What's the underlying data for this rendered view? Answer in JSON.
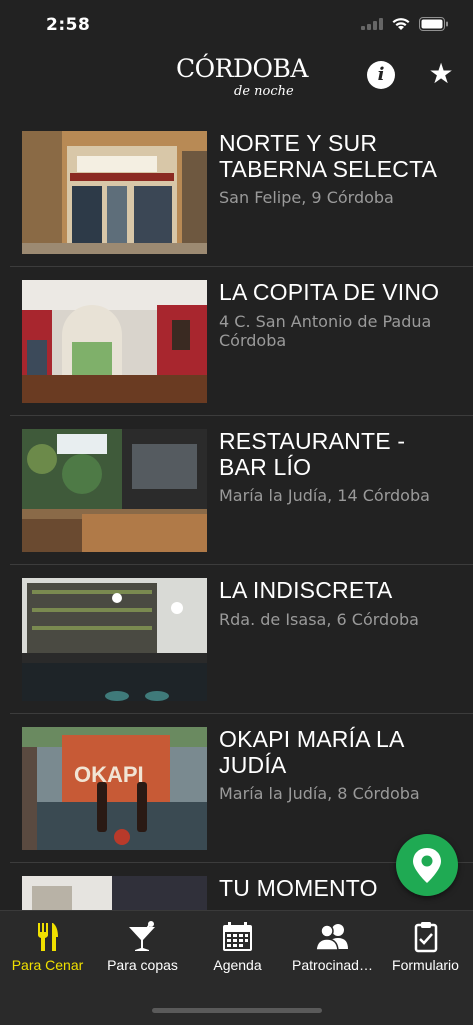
{
  "status": {
    "time": "2:58"
  },
  "header": {
    "logo_main": "CÓRDOBA",
    "logo_sub": "de noche",
    "info_label": "i"
  },
  "items": [
    {
      "title": "NORTE Y SUR TABERNA SELECTA",
      "address": "San Felipe, 9 Córdoba"
    },
    {
      "title": "LA COPITA DE VINO",
      "address": "4 C. San Antonio de Padua Córdoba"
    },
    {
      "title": "RESTAURANTE - BAR LÍO",
      "address": "María la Judía, 14 Córdoba"
    },
    {
      "title": "LA INDISCRETA",
      "address": "Rda. de Isasa, 6 Córdoba"
    },
    {
      "title": "OKAPI MARÍA LA JUDÍA",
      "address": "María la Judía, 8 Córdoba"
    },
    {
      "title": "TU MOMENTO",
      "address": ""
    }
  ],
  "tabs": [
    {
      "label": "Para Cenar",
      "icon": "fork-knife-icon",
      "active": true
    },
    {
      "label": "Para copas",
      "icon": "cocktail-icon",
      "active": false
    },
    {
      "label": "Agenda",
      "icon": "calendar-icon",
      "active": false
    },
    {
      "label": "Patrocinad…",
      "icon": "users-icon",
      "active": false
    },
    {
      "label": "Formulario",
      "icon": "clipboard-icon",
      "active": false
    }
  ],
  "colors": {
    "background": "#222222",
    "active_tab": "#f0e000",
    "map_button": "#1faa53",
    "address_text": "#9a9a9a"
  }
}
